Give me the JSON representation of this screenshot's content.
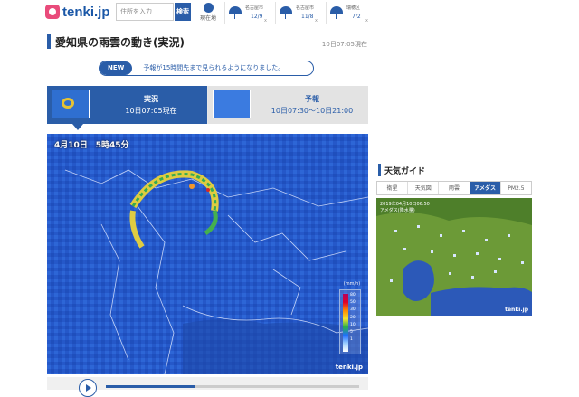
{
  "header": {
    "logo_text": "tenki.jp",
    "search_placeholder": "住所を入力",
    "search_button": "検索",
    "current_location": "現在地",
    "weather_items": [
      {
        "city": "名古屋市",
        "date": "12/9"
      },
      {
        "city": "名古屋市",
        "date": "11/8"
      },
      {
        "city": "瑞穂区",
        "date": "7/2"
      }
    ],
    "close_glyph": "x"
  },
  "page": {
    "title": "愛知県の雨雲の動き(実況)",
    "timestamp": "10日07:05現在"
  },
  "notice": {
    "badge": "NEW",
    "text": "予報が15時間先まで見られるようになりました。"
  },
  "tabs": {
    "now": {
      "label": "実況",
      "time": "10日07:05現在"
    },
    "forecast": {
      "label": "予報",
      "time": "10日07:30～10日21:00"
    }
  },
  "radar": {
    "time_label": "4月10日　5時45分",
    "unit": "(mm/h)",
    "legend_values": [
      "80",
      "50",
      "30",
      "20",
      "10",
      "5",
      "1"
    ],
    "logo": "tenki.jp"
  },
  "guide": {
    "title": "天気ガイド",
    "tabs": [
      "衛星",
      "天気図",
      "雨雲",
      "アメダス",
      "PM2.5"
    ],
    "active_tab": "アメダス",
    "map_time": "2019年04月10日06:50",
    "map_sub": "アメダス(降水量)",
    "logo": "tenki.jp"
  },
  "colors": {
    "brand_blue": "#2a5da8",
    "radar_bg": "#2558c9",
    "amedas_land": "#6c9a37"
  }
}
